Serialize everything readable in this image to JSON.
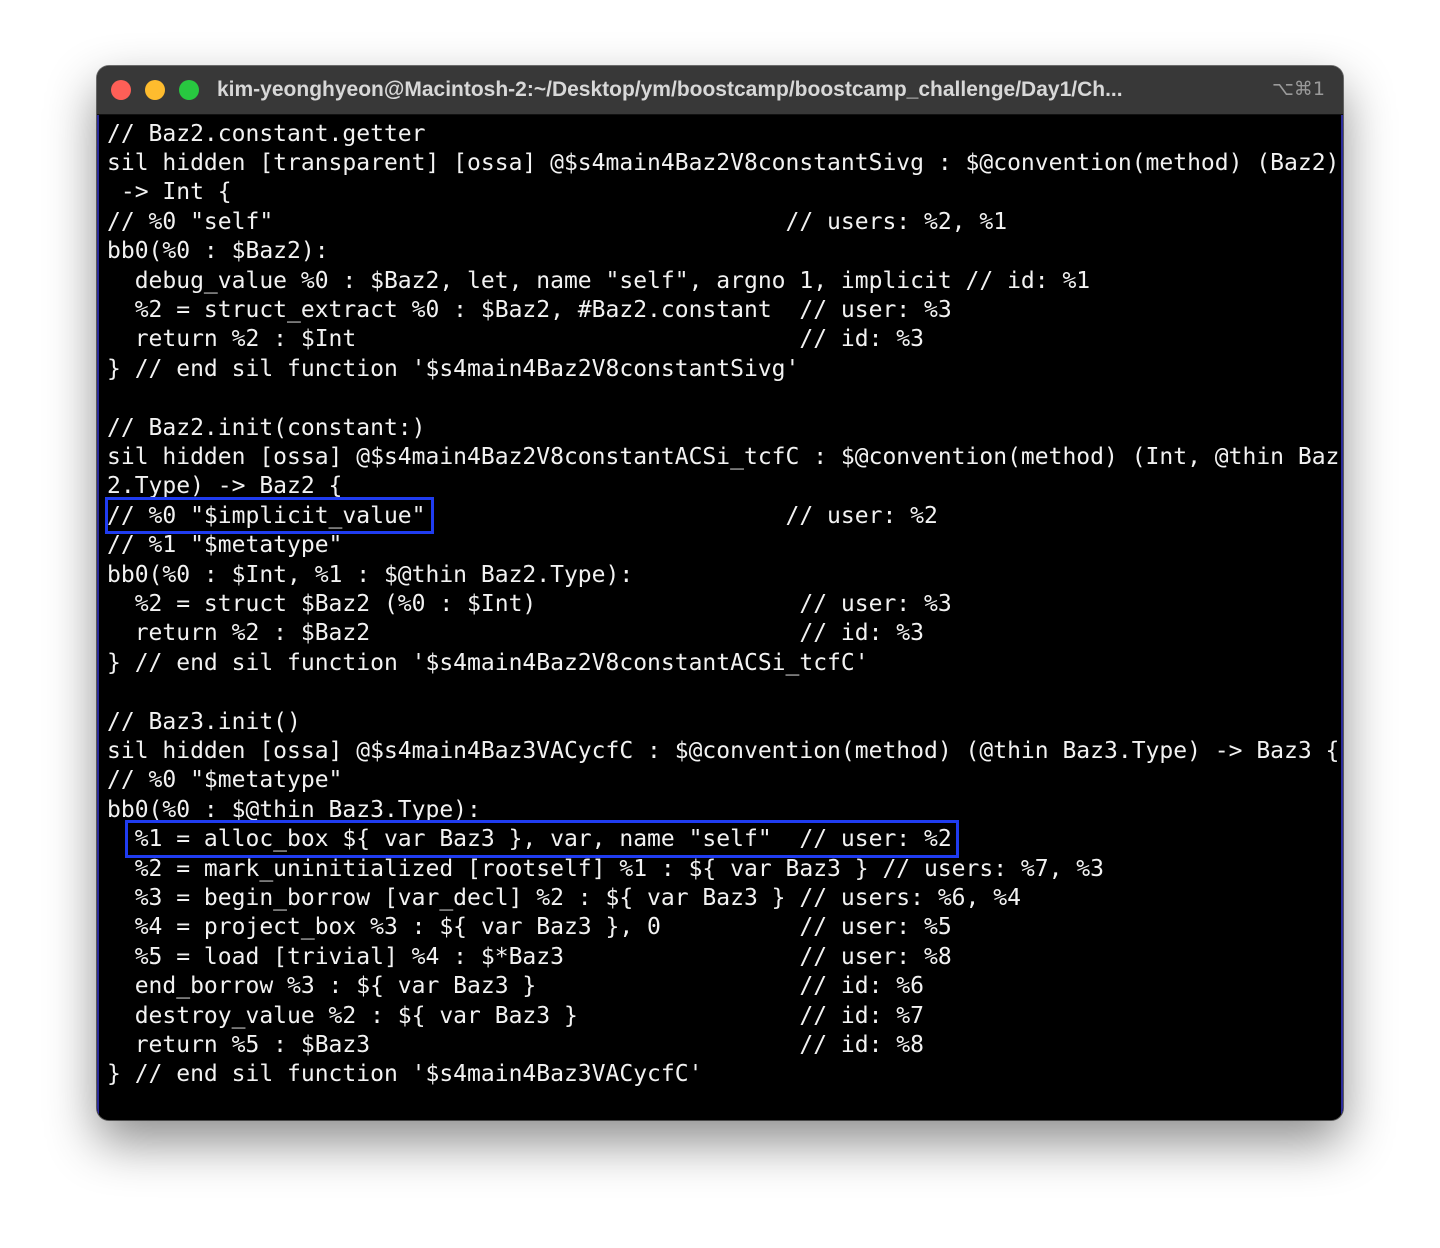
{
  "window": {
    "title": "kim-yeonghyeon@Macintosh-2:~/Desktop/ym/boostcamp/boostcamp_challenge/Day1/Ch...",
    "shortcut": "⌥⌘1"
  },
  "terminal": {
    "lines": [
      "// Baz2.constant.getter",
      "sil hidden [transparent] [ossa] @$s4main4Baz2V8constantSivg : $@convention(method) (Baz2)",
      " -> Int {",
      "// %0 \"self\"                                     // users: %2, %1",
      "bb0(%0 : $Baz2):",
      "  debug_value %0 : $Baz2, let, name \"self\", argno 1, implicit // id: %1",
      "  %2 = struct_extract %0 : $Baz2, #Baz2.constant  // user: %3",
      "  return %2 : $Int                                // id: %3",
      "} // end sil function '$s4main4Baz2V8constantSivg'",
      "",
      "// Baz2.init(constant:)",
      "sil hidden [ossa] @$s4main4Baz2V8constantACSi_tcfC : $@convention(method) (Int, @thin Baz",
      "2.Type) -> Baz2 {",
      "// %0 \"$implicit_value\"                          // user: %2",
      "// %1 \"$metatype\"",
      "bb0(%0 : $Int, %1 : $@thin Baz2.Type):",
      "  %2 = struct $Baz2 (%0 : $Int)                   // user: %3",
      "  return %2 : $Baz2                               // id: %3",
      "} // end sil function '$s4main4Baz2V8constantACSi_tcfC'",
      "",
      "// Baz3.init()",
      "sil hidden [ossa] @$s4main4Baz3VACycfC : $@convention(method) (@thin Baz3.Type) -> Baz3 {",
      "// %0 \"$metatype\"",
      "bb0(%0 : $@thin Baz3.Type):",
      "  %1 = alloc_box ${ var Baz3 }, var, name \"self\"  // user: %2",
      "  %2 = mark_uninitialized [rootself] %1 : ${ var Baz3 } // users: %7, %3",
      "  %3 = begin_borrow [var_decl] %2 : ${ var Baz3 } // users: %6, %4",
      "  %4 = project_box %3 : ${ var Baz3 }, 0          // user: %5",
      "  %5 = load [trivial] %4 : $*Baz3                 // user: %8",
      "  end_borrow %3 : ${ var Baz3 }                   // id: %6",
      "  destroy_value %2 : ${ var Baz3 }                // id: %7",
      "  return %5 : $Baz3                               // id: %8",
      "} // end sil function '$s4main4Baz3VACycfC'"
    ]
  },
  "colors": {
    "terminal_background": "#000000",
    "text": "#f2f2f2",
    "titlebar": "#383838",
    "highlight_box": "#1f3cf0",
    "close_button": "#ff5f57",
    "minimize_button": "#febc2e",
    "zoom_button": "#28c840"
  }
}
